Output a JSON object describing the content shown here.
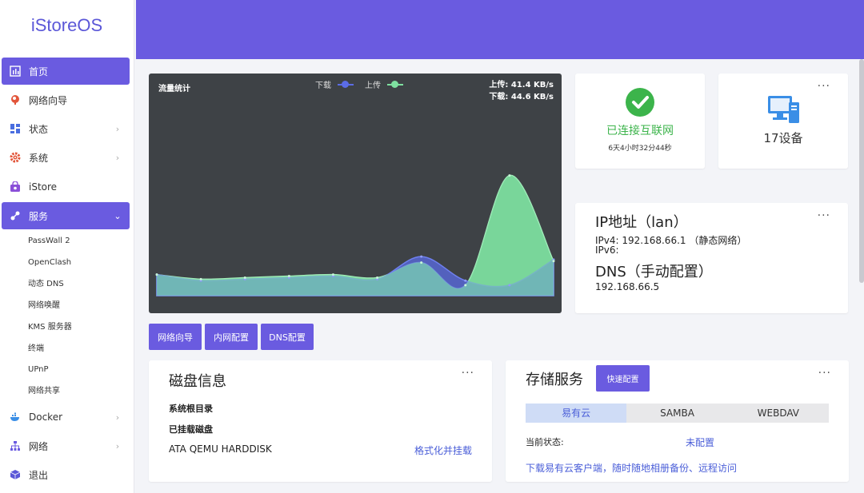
{
  "app": {
    "logo": "iStoreOS"
  },
  "sidebar": {
    "items": [
      {
        "label": "首页",
        "icon": "chart-icon",
        "chevron": ""
      },
      {
        "label": "网络向导",
        "icon": "globe-icon",
        "chevron": ""
      },
      {
        "label": "状态",
        "icon": "dashboard-icon",
        "chevron": "›"
      },
      {
        "label": "系统",
        "icon": "gear-icon",
        "chevron": "›"
      },
      {
        "label": "iStore",
        "icon": "store-icon",
        "chevron": ""
      },
      {
        "label": "服务",
        "icon": "services-icon",
        "chevron": "⌄"
      },
      {
        "label": "Docker",
        "icon": "docker-icon",
        "chevron": "›"
      },
      {
        "label": "网络",
        "icon": "network-icon",
        "chevron": "›"
      },
      {
        "label": "退出",
        "icon": "logout-icon",
        "chevron": ""
      }
    ],
    "service_subitems": [
      "PassWall 2",
      "OpenClash",
      "动态 DNS",
      "网络唤醒",
      "KMS 服务器",
      "终端",
      "UPnP",
      "网络共享"
    ]
  },
  "traffic": {
    "title": "流量统计",
    "legend_download": "下载",
    "legend_upload": "上传",
    "upload_speed": "上传: 41.4 KB/s",
    "download_speed": "下载: 44.6 KB/s",
    "colors": {
      "download": "#5b6ce6",
      "upload": "#7ee0a0"
    }
  },
  "chart_data": {
    "type": "area",
    "title": "流量统计",
    "series": [
      {
        "name": "下载",
        "values": [
          0.14,
          0.1,
          0.11,
          0.12,
          0.13,
          0.11,
          0.26,
          0.1,
          0.07,
          0.24
        ]
      },
      {
        "name": "上传",
        "values": [
          0.14,
          0.11,
          0.12,
          0.13,
          0.14,
          0.12,
          0.22,
          0.07,
          0.8,
          0.23
        ]
      }
    ],
    "ylim": [
      0,
      1
    ]
  },
  "buttons": {
    "wizard": "网络向导",
    "lan": "内网配置",
    "dns": "DNS配置"
  },
  "connection": {
    "status": "已连接互联网",
    "uptime": "6天4小时32分44秒"
  },
  "devices": {
    "count_label": "17设备"
  },
  "ip": {
    "title": "IP地址（lan）",
    "ipv4": "IPv4:  192.168.66.1 （静态网络）",
    "ipv6": "IPv6:",
    "dns_title": "DNS（手动配置）",
    "dns_value": "192.168.66.5"
  },
  "disk": {
    "title": "磁盘信息",
    "root_label": "系统根目录",
    "mounted_label": "已挂载磁盘",
    "disk_name": "ATA QEMU HARDDISK",
    "format_link": "格式化并挂载"
  },
  "storage": {
    "title": "存储服务",
    "quick_button": "快速配置",
    "tabs": [
      "易有云",
      "SAMBA",
      "WEBDAV"
    ],
    "status_label": "当前状态:",
    "status_value": "未配置",
    "download_link": "下载易有云客户端，随时随地相册备份、远程访问"
  },
  "more": "···"
}
